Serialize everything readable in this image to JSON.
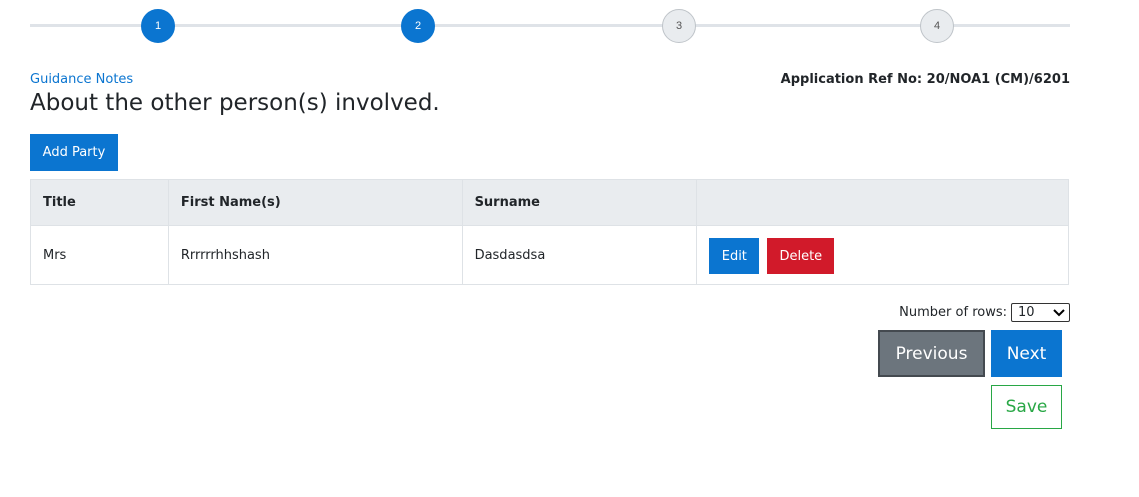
{
  "stepper": {
    "steps": [
      {
        "label": "1",
        "state": "active"
      },
      {
        "label": "2",
        "state": "active"
      },
      {
        "label": "3",
        "state": "inactive"
      },
      {
        "label": "4",
        "state": "inactive"
      }
    ]
  },
  "header": {
    "guidance_link": "Guidance Notes",
    "app_ref": "Application Ref No: 20/NOA1 (CM)/6201",
    "title": "About the other person(s) involved."
  },
  "toolbar": {
    "add_party_label": "Add Party"
  },
  "table": {
    "headers": [
      "Title",
      "First Name(s)",
      "Surname",
      ""
    ],
    "rows": [
      {
        "title": "Mrs",
        "first_names": "Rrrrrrhhshash",
        "surname": "Dasdasdsa",
        "edit_label": "Edit",
        "delete_label": "Delete"
      }
    ]
  },
  "pagination": {
    "rows_label": "Number of rows:",
    "rows_value": "10"
  },
  "nav": {
    "previous_label": "Previous",
    "next_label": "Next",
    "save_label": "Save"
  },
  "colors": {
    "primary": "#0b75d0",
    "danger": "#d11a2a",
    "secondary": "#6c757d",
    "success": "#28a745"
  }
}
